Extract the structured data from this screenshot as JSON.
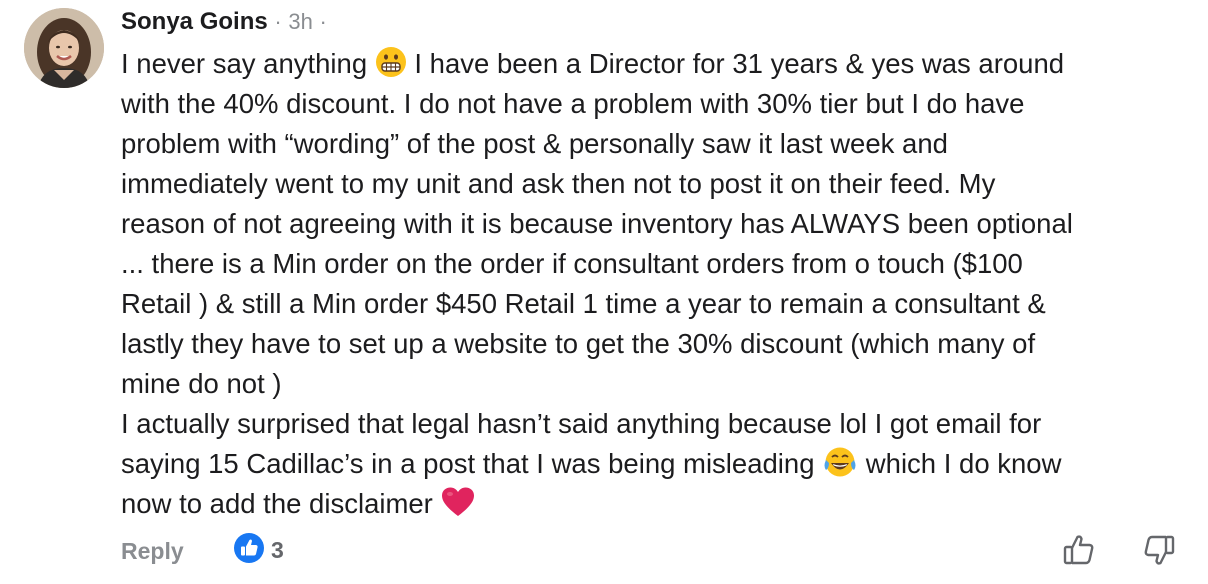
{
  "comment": {
    "author": "Sonya Goins",
    "separator_1": "·",
    "timestamp": "3h",
    "separator_2": "·",
    "lines": [
      {
        "segments": [
          "I never say anything ",
          " I have been a Director for 31 years & yes was around"
        ]
      },
      {
        "text": "with the 40% discount. I do not have a problem with 30% tier but I do have"
      },
      {
        "text": "problem with “wording” of the post & personally saw it last week and"
      },
      {
        "text": "immediately went to my unit and ask then not to post it on their feed.  My"
      },
      {
        "text": "reason of not agreeing with it is because inventory has ALWAYS been optional"
      },
      {
        "text": "... there is a Min order on the order if consultant orders from o touch ($100"
      },
      {
        "text": "Retail ) & still a Min order $450 Retail 1 time a year to remain a consultant &"
      },
      {
        "text": "lastly they have to set up a website to get the 30% discount (which many of"
      },
      {
        "text": "mine do not )"
      },
      {
        "text": "I actually surprised that legal hasn’t said anything because lol I got email for"
      },
      {
        "segments": [
          "saying 15 Cadillac’s in a post that  I was being misleading ",
          " which I do know"
        ]
      },
      {
        "segments": [
          "now to add the disclaimer ",
          ""
        ]
      }
    ],
    "emojis": {
      "grimacing": "grimacing-face-emoji",
      "laughing": "tears-of-joy-emoji",
      "heart": "red-heart-emoji"
    }
  },
  "actions": {
    "reply_label": "Reply",
    "like_count": "3",
    "like_icon": "thumbs-up-reaction-icon",
    "upvote_icon": "thumbs-up-outline-icon",
    "downvote_icon": "thumbs-down-outline-icon"
  },
  "colors": {
    "text": "#1c1c1e",
    "muted": "#8a8d91",
    "like_blue": "#1877f2",
    "heart_red": "#e0245e",
    "emoji_yellow": "#fcc21b"
  }
}
